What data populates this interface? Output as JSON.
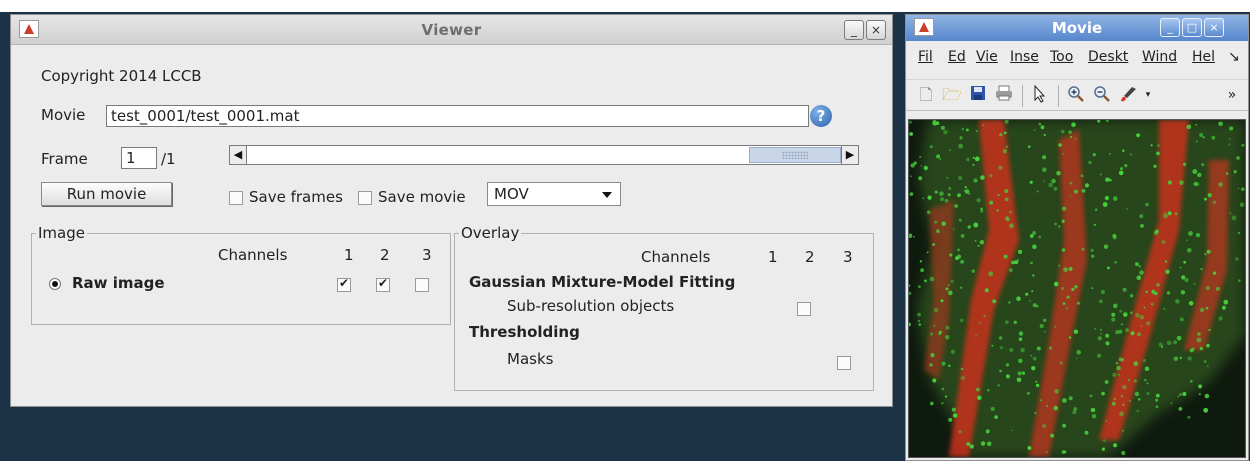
{
  "viewer": {
    "title": "Viewer",
    "minimize_label": "_",
    "close_label": "×",
    "copyright": "Copyright 2014 LCCB",
    "movie_label": "Movie",
    "movie_path": "test_0001/test_0001.mat",
    "help_label": "?",
    "frame_label": "Frame",
    "frame_value": "1",
    "frame_total": "/1",
    "slider_left": "◀",
    "slider_right": "▶",
    "slider_position": 1.0,
    "run_movie_label": "Run movie",
    "save_frames_label": "Save frames",
    "save_frames_checked": false,
    "save_movie_label": "Save movie",
    "save_movie_checked": false,
    "format_value": "MOV",
    "image_panel": {
      "title": "Image",
      "channels_label": "Channels",
      "channel_numbers": [
        "1",
        "2",
        "3"
      ],
      "raw_image_label": "Raw image",
      "raw_image_selected": true,
      "channel_checked": [
        true,
        true,
        false
      ]
    },
    "overlay_panel": {
      "title": "Overlay",
      "channels_label": "Channels",
      "channel_numbers": [
        "1",
        "2",
        "3"
      ],
      "gmm_heading": "Gaussian Mixture-Model Fitting",
      "subres_label": "Sub-resolution objects",
      "subres_checked": false,
      "threshold_heading": "Thresholding",
      "masks_label": "Masks",
      "masks_checked": false
    }
  },
  "movie_window": {
    "title": "Movie",
    "minimize_label": "_",
    "maximize_label": "□",
    "close_label": "×",
    "menu": [
      "Fil",
      "Ed",
      "Vie",
      "Inse",
      "Too",
      "Deskt",
      "Wind",
      "Hel",
      "↘"
    ],
    "toolbar_icons": [
      "new-file-icon",
      "open-folder-icon",
      "save-disk-icon",
      "print-icon",
      "pointer-icon",
      "zoom-in-icon",
      "zoom-out-icon",
      "data-cursor-brush-icon"
    ],
    "overflow_label": "»",
    "image_colors": {
      "red": "#c8331e",
      "green": "#46d23c",
      "background": "#0f1a0f"
    }
  }
}
